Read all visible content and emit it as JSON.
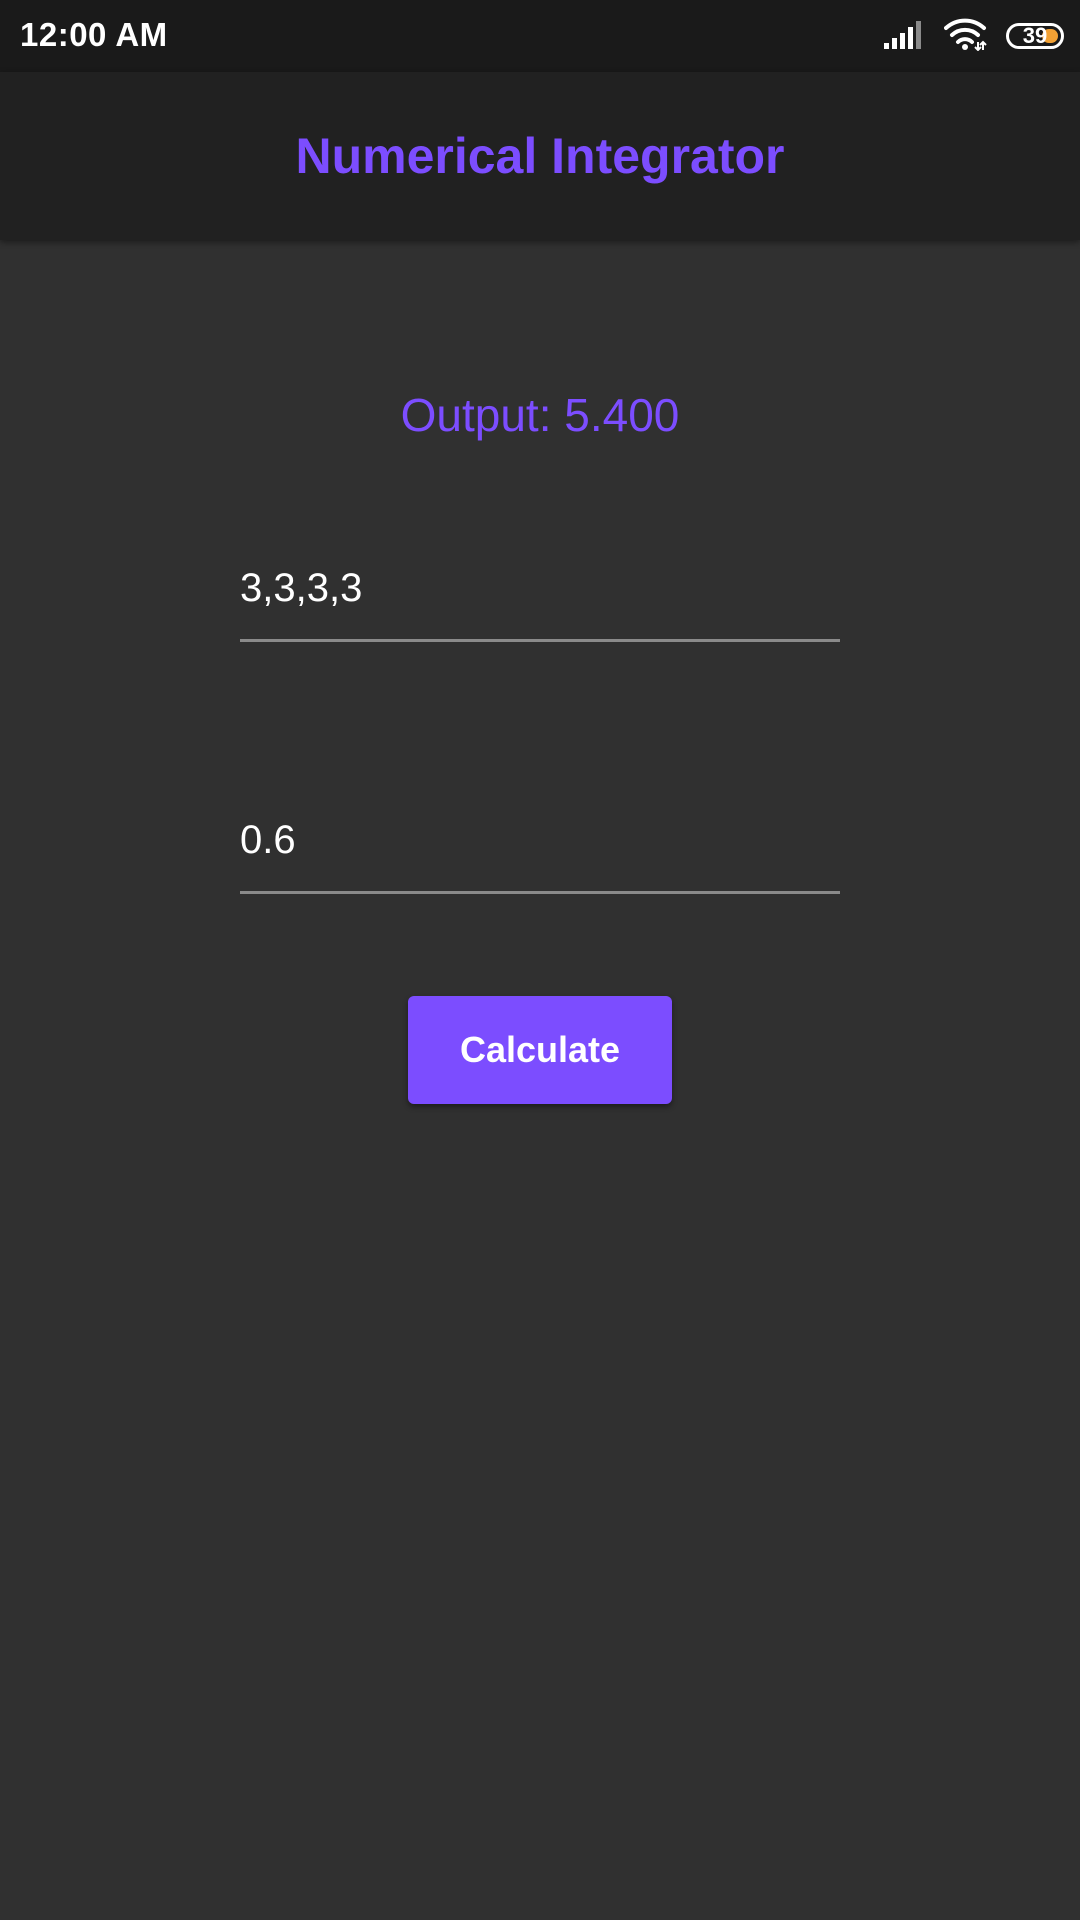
{
  "status_bar": {
    "time": "12:00 AM",
    "battery_level": "39",
    "battery_accent": "#f2a134",
    "icons": [
      "signal-icon",
      "wifi-icon",
      "battery-icon"
    ]
  },
  "app_bar": {
    "title": "Numerical Integrator"
  },
  "output": {
    "label": "Output: 5.400"
  },
  "inputs": {
    "values_field": "3,3,3,3",
    "step_field": "0.6"
  },
  "actions": {
    "calculate_label": "Calculate"
  },
  "colors": {
    "accent": "#7c4dff",
    "background": "#303030",
    "app_bar": "#212121",
    "status_bar": "#1a1a1a"
  }
}
